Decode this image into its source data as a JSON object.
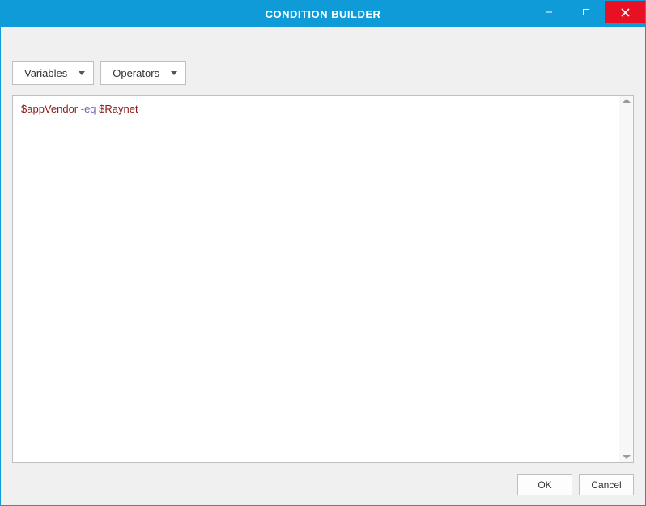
{
  "window": {
    "title": "CONDITION BUILDER"
  },
  "toolbar": {
    "variables_label": "Variables",
    "operators_label": "Operators"
  },
  "editor": {
    "token_var1": "$appVendor",
    "token_op": "-eq",
    "token_var2": "$Raynet"
  },
  "buttons": {
    "ok": "OK",
    "cancel": "Cancel"
  }
}
